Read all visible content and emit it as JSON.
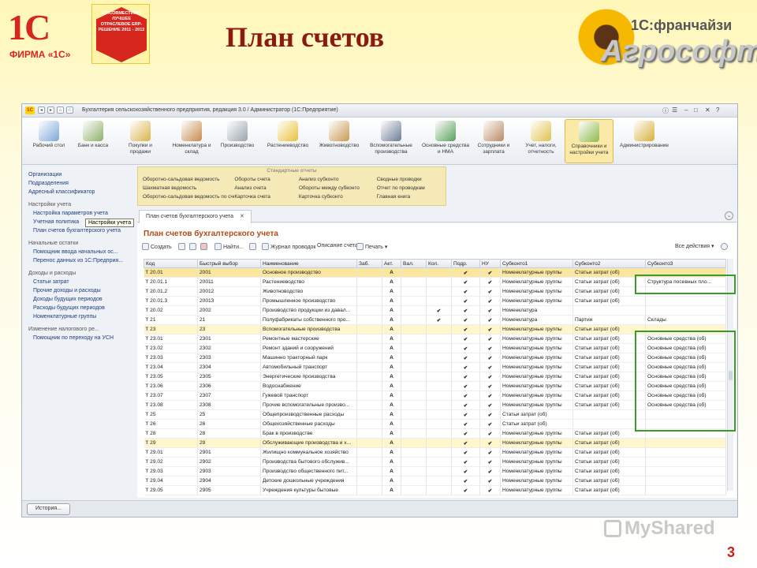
{
  "header": {
    "logo_1c": "1С",
    "logo_1c_sub": "ФИРМА «1С»",
    "badge_text": "1С:СОВМЕСТИМО ЛУЧШЕЕ ОТРАСЛЕВОЕ ERP-РЕШЕНИЕ 2011 - 2012",
    "title": "План счетов",
    "franchise": "1С:франчайзи",
    "brand": "Агрософт"
  },
  "window": {
    "title": "Бухгалтерия сельскохозяйственного предприятия, редакция 3.0 / Администратор  (1С:Предприятие)",
    "sections": [
      {
        "label": "Рабочий стол",
        "icon": "desktop-icon",
        "color": "#7fa7d8"
      },
      {
        "label": "Банк и касса",
        "icon": "bank-icon",
        "color": "#8fb06a"
      },
      {
        "label": "Покупки и продажи",
        "icon": "truck-icon",
        "color": "#d9b34a"
      },
      {
        "label": "Номенклатура и склад",
        "icon": "warehouse-icon",
        "color": "#c58b4a"
      },
      {
        "label": "Производство",
        "icon": "factory-icon",
        "color": "#9aa4b0"
      },
      {
        "label": "Растениеводство",
        "icon": "plant-icon",
        "color": "#e8c13a"
      },
      {
        "label": "Животноводство",
        "icon": "cow-icon",
        "color": "#c89a52"
      },
      {
        "label": "Вспомогательные производства",
        "icon": "tractor-icon",
        "color": "#6b7d96"
      },
      {
        "label": "Основные средства и НМА",
        "icon": "assets-icon",
        "color": "#5aa05a"
      },
      {
        "label": "Сотрудники и зарплата",
        "icon": "employee-icon",
        "color": "#b98a62"
      },
      {
        "label": "Учет, налоги, отчетность",
        "icon": "report-icon",
        "color": "#e0c24a"
      },
      {
        "label": "Справочники и настройки учета",
        "icon": "books-icon",
        "color": "#8fb84a"
      },
      {
        "label": "Администрирование",
        "icon": "admin-icon",
        "color": "#d8b03a"
      }
    ],
    "left_panel": {
      "links_top": [
        "Организации",
        "Подразделения",
        "Адресный классификатор"
      ],
      "group_settings": "Настройки учета",
      "links_settings": [
        "Настройка параметров учета",
        "Учетная политика",
        "План счетов бухгалтерского учета"
      ],
      "group_opening": "Начальные остатки",
      "links_opening": [
        "Помощник ввода начальных ос...",
        "Перенос данных из 1С:Предприя..."
      ],
      "group_income": "Доходы и расходы",
      "links_income": [
        "Статьи затрат",
        "Прочие доходы и расходы",
        "Доходы будущих периодов",
        "Расходы будущих периодов",
        "Номенклатурные группы"
      ],
      "group_tax": "Изменение налогового ре...",
      "links_tax": [
        "Помощник по переходу на УСН"
      ],
      "tooltip": "Настройки учета"
    },
    "reports": {
      "header": "Стандартные отчеты",
      "col1": [
        "Оборотно-сальдовая ведомость",
        "Шахматная ведомость",
        "Оборотно-сальдовая ведомость по счету"
      ],
      "col2": [
        "Обороты счета",
        "Анализ счета",
        "Карточка счета"
      ],
      "col3": [
        "Анализ субконто",
        "Обороты между субконто",
        "Карточка субконто"
      ],
      "col4": [
        "Сводные проводки",
        "Отчет по проводкам",
        "Главная книга"
      ]
    },
    "tab_label": "План счетов бухгалтерского учета",
    "form_title": "План счетов бухгалтерского учета",
    "toolbar": {
      "create": "Создать",
      "find": "Найти...",
      "journal": "Журнал проводок",
      "description": "Описание счета",
      "print": "Печать",
      "all_actions": "Все действия"
    },
    "columns": [
      "Код",
      "Быстрый выбор",
      "Наименование",
      "Заб.",
      "Акт.",
      "Вал.",
      "Кол.",
      "Подр.",
      "НУ",
      "Субконто1",
      "Субконто2",
      "Субконто3"
    ],
    "rows": [
      {
        "code": "20.01",
        "quick": "2001",
        "name": "Основное производство",
        "zab": "",
        "akt": "А",
        "val": "",
        "kol": "",
        "podr": "✔",
        "nu": "✔",
        "s1": "Номенклатурные группы",
        "s2": "Статьи затрат (об)",
        "s3": "",
        "style": "sel"
      },
      {
        "code": "20.01.1",
        "quick": "20011",
        "name": "Растениеводство",
        "zab": "",
        "akt": "А",
        "val": "",
        "kol": "",
        "podr": "✔",
        "nu": "✔",
        "s1": "Номенклатурные группы",
        "s2": "Статьи затрат (об)",
        "s3": "Структура посевных пло...",
        "style": ""
      },
      {
        "code": "20.01.2",
        "quick": "20012",
        "name": "Животноводство",
        "zab": "",
        "akt": "А",
        "val": "",
        "kol": "",
        "podr": "✔",
        "nu": "✔",
        "s1": "Номенклатурные группы",
        "s2": "Статьи затрат (об)",
        "s3": "",
        "style": ""
      },
      {
        "code": "20.01.3",
        "quick": "20013",
        "name": "Промышленное производство",
        "zab": "",
        "akt": "А",
        "val": "",
        "kol": "",
        "podr": "✔",
        "nu": "✔",
        "s1": "Номенклатурные группы",
        "s2": "Статьи затрат (об)",
        "s3": "",
        "style": ""
      },
      {
        "code": "20.02",
        "quick": "2002",
        "name": "Производство продукции из давал...",
        "zab": "",
        "akt": "А",
        "val": "",
        "kol": "✔",
        "podr": "✔",
        "nu": "✔",
        "s1": "Номенклатура",
        "s2": "",
        "s3": "",
        "style": ""
      },
      {
        "code": "21",
        "quick": "21",
        "name": "Полуфабрикаты собственного про...",
        "zab": "",
        "akt": "А",
        "val": "",
        "kol": "✔",
        "podr": "✔",
        "nu": "✔",
        "s1": "Номенклатура",
        "s2": "Партии",
        "s3": "Склады",
        "style": ""
      },
      {
        "code": "23",
        "quick": "23",
        "name": "Вспомогательные производства",
        "zab": "",
        "akt": "А",
        "val": "",
        "kol": "",
        "podr": "✔",
        "nu": "✔",
        "s1": "Номенклатурные группы",
        "s2": "Статьи затрат (об)",
        "s3": "",
        "style": "yel"
      },
      {
        "code": "23.01",
        "quick": "2301",
        "name": "Ремонтные мастерские",
        "zab": "",
        "akt": "А",
        "val": "",
        "kol": "",
        "podr": "✔",
        "nu": "✔",
        "s1": "Номенклатурные группы",
        "s2": "Статьи затрат (об)",
        "s3": "Основные средства (об)",
        "style": ""
      },
      {
        "code": "23.02",
        "quick": "2302",
        "name": "Ремонт зданий и сооружений",
        "zab": "",
        "akt": "А",
        "val": "",
        "kol": "",
        "podr": "✔",
        "nu": "✔",
        "s1": "Номенклатурные группы",
        "s2": "Статьи затрат (об)",
        "s3": "Основные средства (об)",
        "style": ""
      },
      {
        "code": "23.03",
        "quick": "2303",
        "name": "Машинно тракторный парк",
        "zab": "",
        "akt": "А",
        "val": "",
        "kol": "",
        "podr": "✔",
        "nu": "✔",
        "s1": "Номенклатурные группы",
        "s2": "Статьи затрат (об)",
        "s3": "Основные средства (об)",
        "style": ""
      },
      {
        "code": "23.04",
        "quick": "2304",
        "name": "Автомобильный транспорт",
        "zab": "",
        "akt": "А",
        "val": "",
        "kol": "",
        "podr": "✔",
        "nu": "✔",
        "s1": "Номенклатурные группы",
        "s2": "Статьи затрат (об)",
        "s3": "Основные средства (об)",
        "style": ""
      },
      {
        "code": "23.05",
        "quick": "2305",
        "name": "Энергетические производства",
        "zab": "",
        "akt": "А",
        "val": "",
        "kol": "",
        "podr": "✔",
        "nu": "✔",
        "s1": "Номенклатурные группы",
        "s2": "Статьи затрат (об)",
        "s3": "Основные средства (об)",
        "style": ""
      },
      {
        "code": "23.06",
        "quick": "2306",
        "name": "Водоснабжение",
        "zab": "",
        "akt": "А",
        "val": "",
        "kol": "",
        "podr": "✔",
        "nu": "✔",
        "s1": "Номенклатурные группы",
        "s2": "Статьи затрат (об)",
        "s3": "Основные средства (об)",
        "style": ""
      },
      {
        "code": "23.07",
        "quick": "2307",
        "name": "Гужевой транспорт",
        "zab": "",
        "akt": "А",
        "val": "",
        "kol": "",
        "podr": "✔",
        "nu": "✔",
        "s1": "Номенклатурные группы",
        "s2": "Статьи затрат (об)",
        "s3": "Основные средства (об)",
        "style": ""
      },
      {
        "code": "23.08",
        "quick": "2308",
        "name": "Прочие вспомогательные произво...",
        "zab": "",
        "akt": "А",
        "val": "",
        "kol": "",
        "podr": "✔",
        "nu": "✔",
        "s1": "Номенклатурные группы",
        "s2": "Статьи затрат (об)",
        "s3": "Основные средства (об)",
        "style": ""
      },
      {
        "code": "25",
        "quick": "25",
        "name": "Общепроизводственные расходы",
        "zab": "",
        "akt": "А",
        "val": "",
        "kol": "",
        "podr": "✔",
        "nu": "✔",
        "s1": "Статьи затрат (об)",
        "s2": "",
        "s3": "",
        "style": ""
      },
      {
        "code": "26",
        "quick": "26",
        "name": "Общехозяйственные расходы",
        "zab": "",
        "akt": "А",
        "val": "",
        "kol": "",
        "podr": "✔",
        "nu": "✔",
        "s1": "Статьи затрат (об)",
        "s2": "",
        "s3": "",
        "style": ""
      },
      {
        "code": "28",
        "quick": "28",
        "name": "Брак в производстве",
        "zab": "",
        "akt": "А",
        "val": "",
        "kol": "",
        "podr": "✔",
        "nu": "✔",
        "s1": "Номенклатурные группы",
        "s2": "Статьи затрат (об)",
        "s3": "",
        "style": ""
      },
      {
        "code": "29",
        "quick": "29",
        "name": "Обслуживающие производства и х...",
        "zab": "",
        "akt": "А",
        "val": "",
        "kol": "",
        "podr": "✔",
        "nu": "✔",
        "s1": "Номенклатурные группы",
        "s2": "Статьи затрат (об)",
        "s3": "",
        "style": "yel"
      },
      {
        "code": "29.01",
        "quick": "2901",
        "name": "Жилищно коммунальное хозяйство",
        "zab": "",
        "akt": "А",
        "val": "",
        "kol": "",
        "podr": "✔",
        "nu": "✔",
        "s1": "Номенклатурные группы",
        "s2": "Статьи затрат (об)",
        "s3": "",
        "style": ""
      },
      {
        "code": "29.02",
        "quick": "2902",
        "name": "Производства бытового обслужив...",
        "zab": "",
        "akt": "А",
        "val": "",
        "kol": "",
        "podr": "✔",
        "nu": "✔",
        "s1": "Номенклатурные группы",
        "s2": "Статьи затрат (об)",
        "s3": "",
        "style": ""
      },
      {
        "code": "29.03",
        "quick": "2903",
        "name": "Производство общественного пит...",
        "zab": "",
        "akt": "А",
        "val": "",
        "kol": "",
        "podr": "✔",
        "nu": "✔",
        "s1": "Номенклатурные группы",
        "s2": "Статьи затрат (об)",
        "s3": "",
        "style": ""
      },
      {
        "code": "29.04",
        "quick": "2904",
        "name": "Детские дошкольные учреждения",
        "zab": "",
        "akt": "А",
        "val": "",
        "kol": "",
        "podr": "✔",
        "nu": "✔",
        "s1": "Номенклатурные группы",
        "s2": "Статьи затрат (об)",
        "s3": "",
        "style": ""
      },
      {
        "code": "29.05",
        "quick": "2905",
        "name": "Учреждения культуры бытовые",
        "zab": "",
        "akt": "А",
        "val": "",
        "kol": "",
        "podr": "✔",
        "nu": "✔",
        "s1": "Номенклатурные группы",
        "s2": "Статьи затрат (об)",
        "s3": "",
        "style": ""
      }
    ],
    "history_button": "История..."
  },
  "footer": {
    "watermark": "MyShared",
    "slide_number": "3"
  },
  "colors": {
    "title": "#8b1a12",
    "brand_red": "#d7261e",
    "highlight_green": "#3a9a2a",
    "row_selected": "#fbe6a0",
    "row_group": "#fff6cc"
  }
}
